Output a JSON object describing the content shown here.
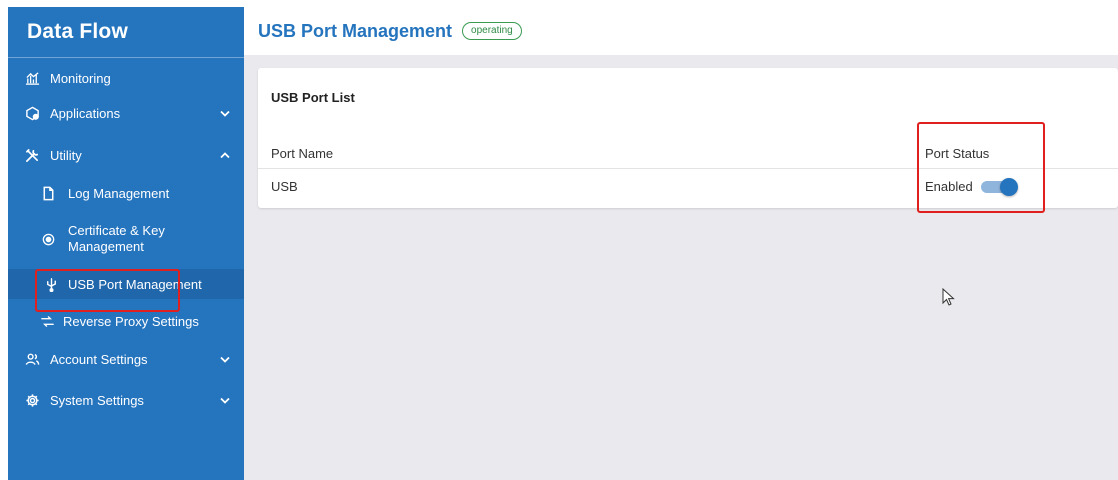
{
  "app": {
    "title": "Data Flow"
  },
  "sidebar": {
    "items": [
      {
        "label": "Monitoring",
        "icon": "chart-icon"
      },
      {
        "label": "Applications",
        "icon": "apps-icon",
        "expandable": true,
        "expanded": false
      },
      {
        "label": "Utility",
        "icon": "tools-icon",
        "expandable": true,
        "expanded": true,
        "children": [
          {
            "label": "Log Management",
            "icon": "file-icon"
          },
          {
            "label_line1": "Certificate & Key",
            "label_line2": "Management",
            "icon": "radio-icon"
          },
          {
            "label": "USB Port Management",
            "icon": "usb-icon",
            "active": true
          },
          {
            "label": "Reverse Proxy Settings",
            "icon": "proxy-icon"
          }
        ]
      },
      {
        "label": "Account Settings",
        "icon": "users-icon",
        "expandable": true,
        "expanded": false
      },
      {
        "label": "System Settings",
        "icon": "gear-icon",
        "expandable": true,
        "expanded": false
      }
    ]
  },
  "header": {
    "title": "USB Port Management",
    "status": "operating"
  },
  "card": {
    "title": "USB Port List",
    "columns": [
      "Port Name",
      "Port Status"
    ],
    "rows": [
      {
        "name": "USB",
        "status_label": "Enabled",
        "enabled": true
      }
    ]
  },
  "colors": {
    "sidebar": "#2574be",
    "accent": "#2574be",
    "status_green": "#3a9a52",
    "highlight": "#e0201e",
    "main_bg": "#eaeaee"
  }
}
